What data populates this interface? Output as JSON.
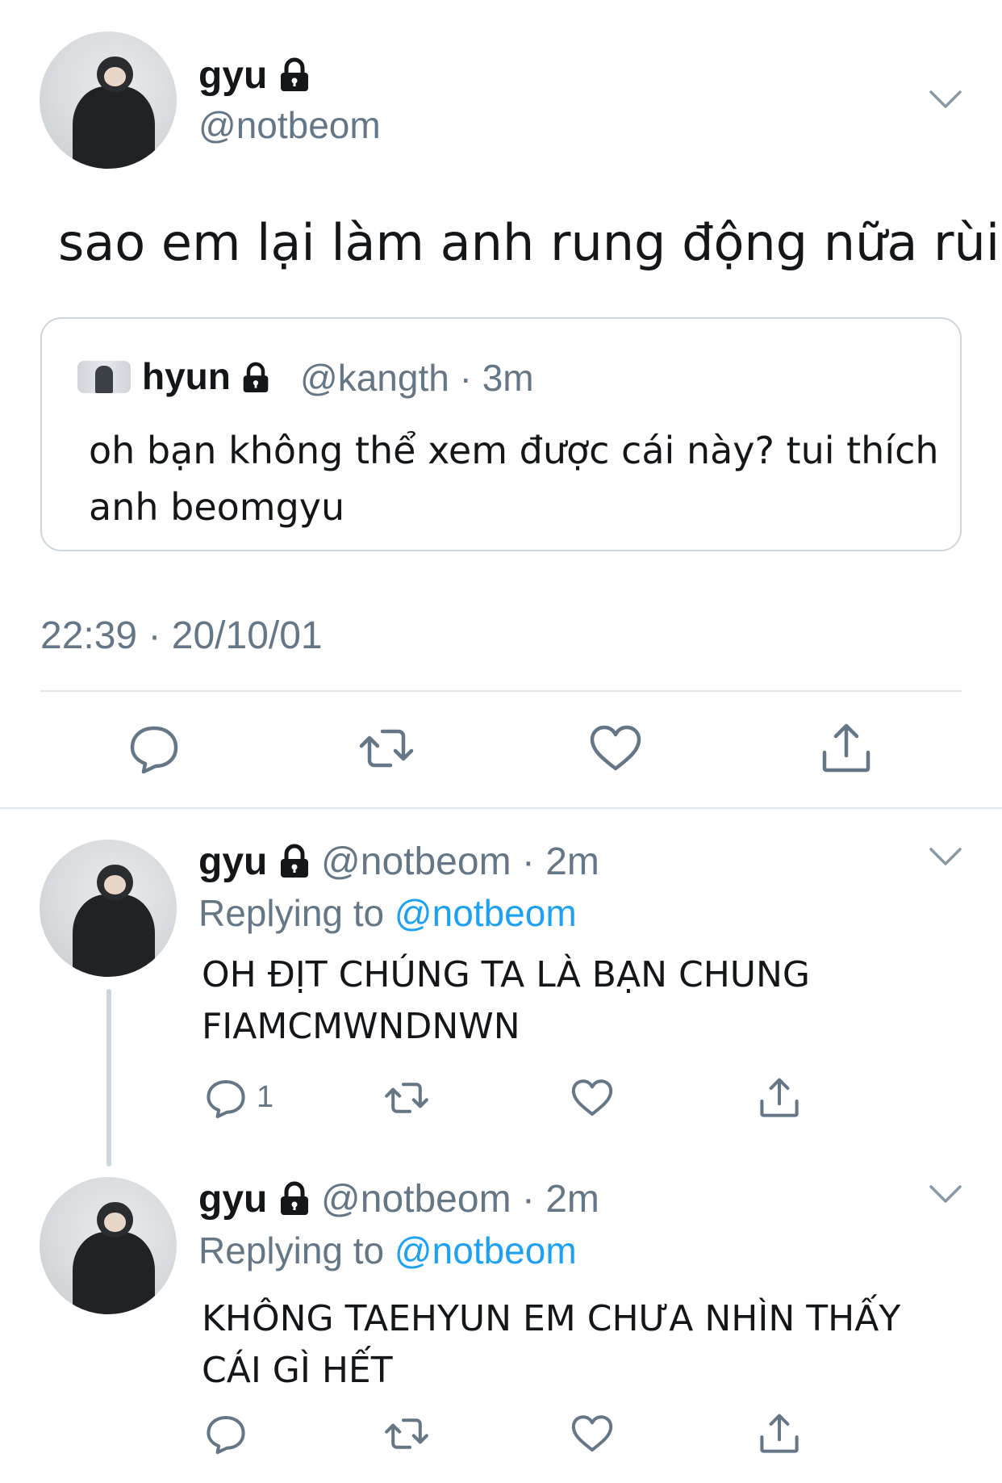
{
  "main_tweet": {
    "name": "gyu",
    "handle": "@notbeom",
    "text": "sao em lại làm anh rung động nữa rùi",
    "timestamp": "22:39 · 20/10/01",
    "quote": {
      "name": "hyun",
      "handle": "@kangth · 3m",
      "text": "oh bạn không thể xem được cái này? tui thích anh beomgyu"
    }
  },
  "replies": [
    {
      "name": "gyu",
      "handle": "@notbeom · 2m",
      "replying_prefix": "Replying to ",
      "replying_to": "@notbeom",
      "text": "OH ĐỊT CHÚNG TA LÀ BẠN CHUNG FIAMCMWNDNWN",
      "reply_count": "1"
    },
    {
      "name": "gyu",
      "handle": "@notbeom · 2m",
      "replying_prefix": "Replying to ",
      "replying_to": "@notbeom",
      "text": "KHÔNG TAEHYUN EM CHƯA NHÌN THẤY CÁI GÌ HẾT"
    }
  ],
  "colors": {
    "text": "#14171a",
    "secondary": "#657786",
    "link": "#1da1f2",
    "border": "#e1e8ed"
  },
  "icons": [
    "lock-icon",
    "chevron-down-icon",
    "reply-icon",
    "retweet-icon",
    "like-icon",
    "share-icon"
  ]
}
